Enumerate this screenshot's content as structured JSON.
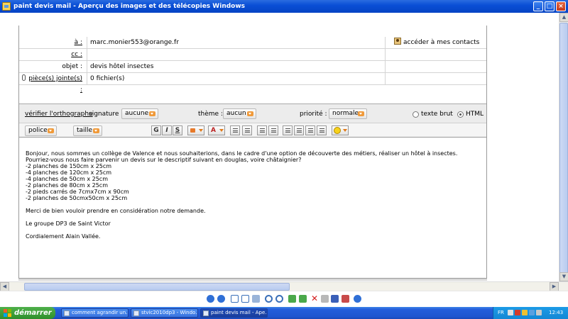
{
  "window": {
    "title": "paint devis mail - Aperçu des images et des télécopies Windows",
    "minimize_glyph": "_",
    "maximize_glyph": "□",
    "close_glyph": "×"
  },
  "mail": {
    "to_label": "à :",
    "to_value": "marc.monier553@orange.fr",
    "contacts_link": "accéder à mes contacts",
    "cc_label": "cc :",
    "cc_value": "",
    "subject_label": "objet :",
    "subject_value": "devis hôtel insectes",
    "attachments_label": "pièce(s) jointe(s) :",
    "attachments_value": "0 fichier(s)"
  },
  "toolbar": {
    "spellcheck": "vérifier l'orthographe",
    "signature_label": "signature :",
    "signature_value": "aucune",
    "theme_label": "thème :",
    "theme_value": "aucun",
    "priority_label": "priorité :",
    "priority_value": "normale",
    "format_plain": "texte brut",
    "format_html": "HTML",
    "format_selected": "HTML",
    "font_label": "police",
    "size_label": "taille",
    "bold": "G",
    "italic": "I",
    "underline": "S",
    "font_color_glyph": "A"
  },
  "body": {
    "paragraphs": [
      [
        "Bonjour, nous sommes un collège de Valence et nous souhaiterions, dans le cadre d'une option de découverte des métiers, réaliser un hôtel à insectes.",
        "Pourriez-vous nous faire parvenir un devis sur le descriptif suivant en douglas, voire châtaignier?",
        "-2 planches de 150cm x 25cm",
        "-4 planches de 120cm x 25cm",
        "-4 planches de 50cm x 25cm",
        "-2 planches de 80cm x 25cm",
        "-2 pieds carrés de 7cmx7cm x 90cm",
        "-2 planches de 50cmx50cm x 25cm"
      ],
      [
        "Merci de bien vouloir prendre en considération notre demande."
      ],
      [
        "Le groupe DP3 de Saint Victor"
      ],
      [
        "Cordialement Alain Vallée."
      ]
    ]
  },
  "taskbar": {
    "start_label": "démarrer",
    "tasks": [
      {
        "label": "comment agrandir un..."
      },
      {
        "label": "stvic2010dp3 - Windo..."
      },
      {
        "label": "paint devis mail - Ape..."
      }
    ],
    "language": "FR",
    "clock": "12:43"
  }
}
